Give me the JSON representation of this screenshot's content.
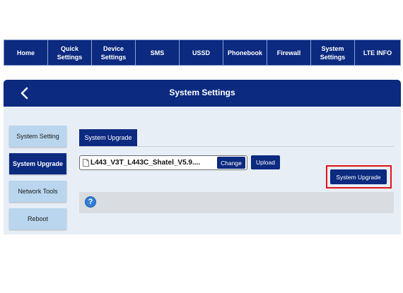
{
  "nav": {
    "items": [
      {
        "label": "Home",
        "name": "nav-home"
      },
      {
        "label": "Quick\nSettings",
        "name": "nav-quick-settings"
      },
      {
        "label": "Device\nSettings",
        "name": "nav-device-settings"
      },
      {
        "label": "SMS",
        "name": "nav-sms"
      },
      {
        "label": "USSD",
        "name": "nav-ussd"
      },
      {
        "label": "Phonebook",
        "name": "nav-phonebook"
      },
      {
        "label": "Firewall",
        "name": "nav-firewall"
      },
      {
        "label": "System\nSettings",
        "name": "nav-system-settings"
      },
      {
        "label": "LTE INFO",
        "name": "nav-lte-info"
      }
    ]
  },
  "header": {
    "title": "System Settings",
    "back_icon": "chevron-left-icon"
  },
  "sidebar": {
    "items": [
      {
        "label": "System Setting",
        "active": false
      },
      {
        "label": "System Upgrade",
        "active": true
      },
      {
        "label": "Network Tools",
        "active": false
      },
      {
        "label": "Reboot",
        "active": false
      }
    ]
  },
  "main": {
    "tab_label": "System Upgrade",
    "file_name": "L443_V3T_L443C_Shatel_V5.9....",
    "change_label": "Change",
    "upload_label": "Upload",
    "system_upgrade_label": "System Upgrade",
    "help_icon": "question-circle-icon"
  },
  "colors": {
    "primary": "#0b2a80",
    "sidebar_inactive": "#b9d6ee",
    "content_bg": "#e7eef6",
    "highlight": "#e0141a",
    "help_icon": "#2f7fd4"
  }
}
